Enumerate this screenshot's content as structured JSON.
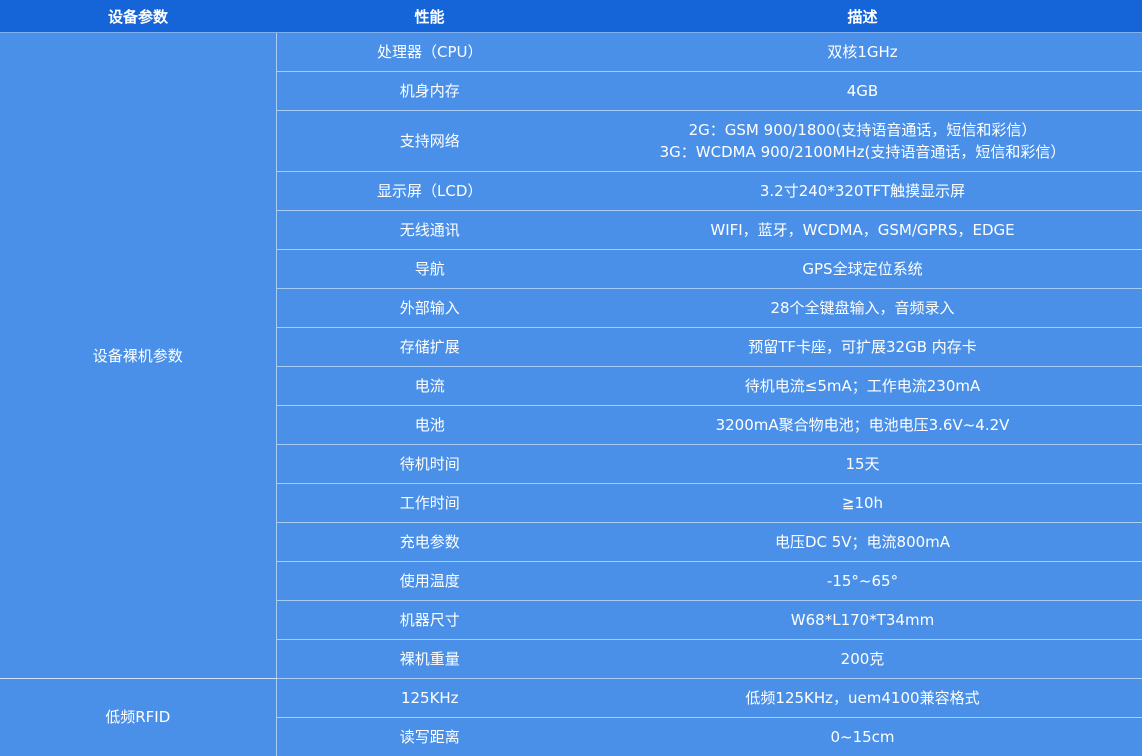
{
  "header": {
    "col1": "设备参数",
    "col2": "性能",
    "col3": "描述"
  },
  "groups": [
    {
      "name": "设备裸机参数"
    },
    {
      "name": "低频RFID"
    }
  ],
  "rows": [
    {
      "prop": "处理器（CPU）",
      "desc": [
        "双核1GHz"
      ]
    },
    {
      "prop": "机身内存",
      "desc": [
        "4GB"
      ]
    },
    {
      "prop": "支持网络",
      "desc": [
        "2G：GSM 900/1800(支持语音通话，短信和彩信）",
        "3G：WCDMA 900/2100MHz(支持语音通话，短信和彩信）"
      ]
    },
    {
      "prop": "显示屏（LCD）",
      "desc": [
        "3.2寸240*320TFT触摸显示屏"
      ]
    },
    {
      "prop": "无线通讯",
      "desc": [
        "WIFI，蓝牙，WCDMA，GSM/GPRS，EDGE"
      ]
    },
    {
      "prop": "导航",
      "desc": [
        "GPS全球定位系统"
      ]
    },
    {
      "prop": "外部输入",
      "desc": [
        "28个全键盘输入，音频录入"
      ]
    },
    {
      "prop": "存储扩展",
      "desc": [
        "预留TF卡座，可扩展32GB 内存卡"
      ]
    },
    {
      "prop": "电流",
      "desc": [
        "待机电流≤5mA；工作电流230mA"
      ]
    },
    {
      "prop": "电池",
      "desc": [
        "3200mA聚合物电池；电池电压3.6V~4.2V"
      ]
    },
    {
      "prop": "待机时间",
      "desc": [
        "15天"
      ]
    },
    {
      "prop": "工作时间",
      "desc": [
        "≧10h"
      ]
    },
    {
      "prop": "充电参数",
      "desc": [
        "电压DC 5V；电流800mA"
      ]
    },
    {
      "prop": "使用温度",
      "desc": [
        "-15°~65°"
      ]
    },
    {
      "prop": "机器尺寸",
      "desc": [
        "W68*L170*T34mm"
      ]
    },
    {
      "prop": "裸机重量",
      "desc": [
        "200克"
      ]
    },
    {
      "prop": "125KHz",
      "desc": [
        "低频125KHz，uem4100兼容格式"
      ]
    },
    {
      "prop": "读写距离",
      "desc": [
        "0~15cm"
      ]
    }
  ],
  "colors": {
    "header_bg": "#1565d8",
    "body_bg": "#4a90e8",
    "divider": "#a9cdf6",
    "text": "#ffffff"
  }
}
